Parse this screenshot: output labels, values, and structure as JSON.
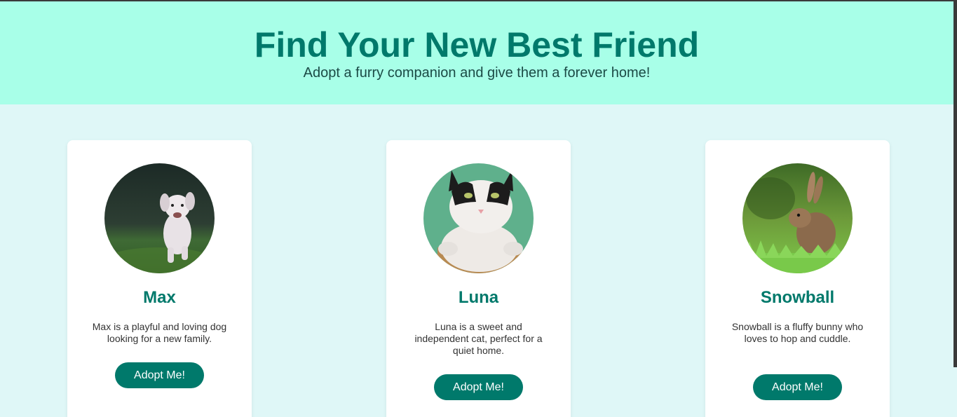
{
  "header": {
    "title": "Find Your New Best Friend",
    "subtitle": "Adopt a furry companion and give them a forever home!"
  },
  "pets": [
    {
      "name": "Max",
      "description": "Max is a playful and loving dog looking for a new family.",
      "button_label": "Adopt Me!",
      "photo": "dog-photo"
    },
    {
      "name": "Luna",
      "description": "Luna is a sweet and independent cat, perfect for a quiet home.",
      "button_label": "Adopt Me!",
      "photo": "cat-photo"
    },
    {
      "name": "Snowball",
      "description": "Snowball is a fluffy bunny who loves to hop and cuddle.",
      "button_label": "Adopt Me!",
      "photo": "rabbit-photo"
    }
  ],
  "colors": {
    "accent": "#00796b",
    "header_bg": "#a8ffe8",
    "page_bg": "#dff7f7"
  }
}
